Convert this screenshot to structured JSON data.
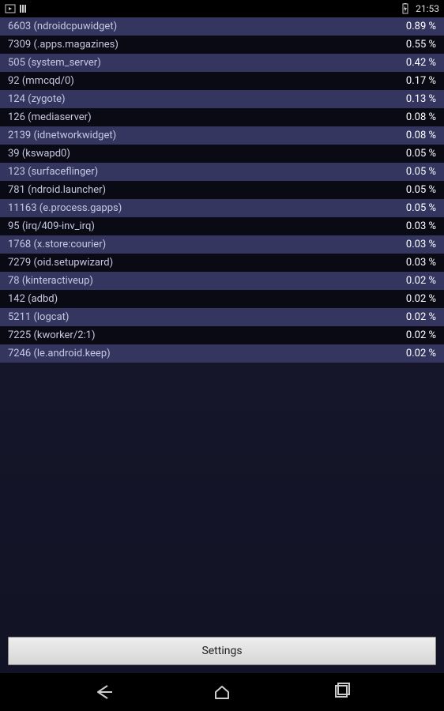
{
  "status": {
    "time": "21:53"
  },
  "processes": [
    {
      "pid": "6603",
      "name": "ndroidcpuwidget",
      "pct": "0.89 %"
    },
    {
      "pid": "7309",
      "name": ".apps.magazines",
      "pct": "0.55 %"
    },
    {
      "pid": "505",
      "name": "system_server",
      "pct": "0.42 %"
    },
    {
      "pid": "92",
      "name": "mmcqd/0",
      "pct": "0.17 %"
    },
    {
      "pid": "124",
      "name": "zygote",
      "pct": "0.13 %"
    },
    {
      "pid": "126",
      "name": "mediaserver",
      "pct": "0.08 %"
    },
    {
      "pid": "2139",
      "name": "idnetworkwidget",
      "pct": "0.08 %"
    },
    {
      "pid": "39",
      "name": "kswapd0",
      "pct": "0.05 %"
    },
    {
      "pid": "123",
      "name": "surfaceflinger",
      "pct": "0.05 %"
    },
    {
      "pid": "781",
      "name": "ndroid.launcher",
      "pct": "0.05 %"
    },
    {
      "pid": "11163",
      "name": "e.process.gapps",
      "pct": "0.05 %"
    },
    {
      "pid": "95",
      "name": "irq/409-inv_irq",
      "pct": "0.03 %"
    },
    {
      "pid": "1768",
      "name": "x.store:courier",
      "pct": "0.03 %"
    },
    {
      "pid": "7279",
      "name": "oid.setupwizard",
      "pct": "0.03 %"
    },
    {
      "pid": "78",
      "name": "kinteractiveup",
      "pct": "0.02 %"
    },
    {
      "pid": "142",
      "name": "adbd",
      "pct": "0.02 %"
    },
    {
      "pid": "5211",
      "name": "logcat",
      "pct": "0.02 %"
    },
    {
      "pid": "7225",
      "name": "kworker/2:1",
      "pct": "0.02 %"
    },
    {
      "pid": "7246",
      "name": "le.android.keep",
      "pct": "0.02 %"
    }
  ],
  "buttons": {
    "settings": "Settings"
  }
}
